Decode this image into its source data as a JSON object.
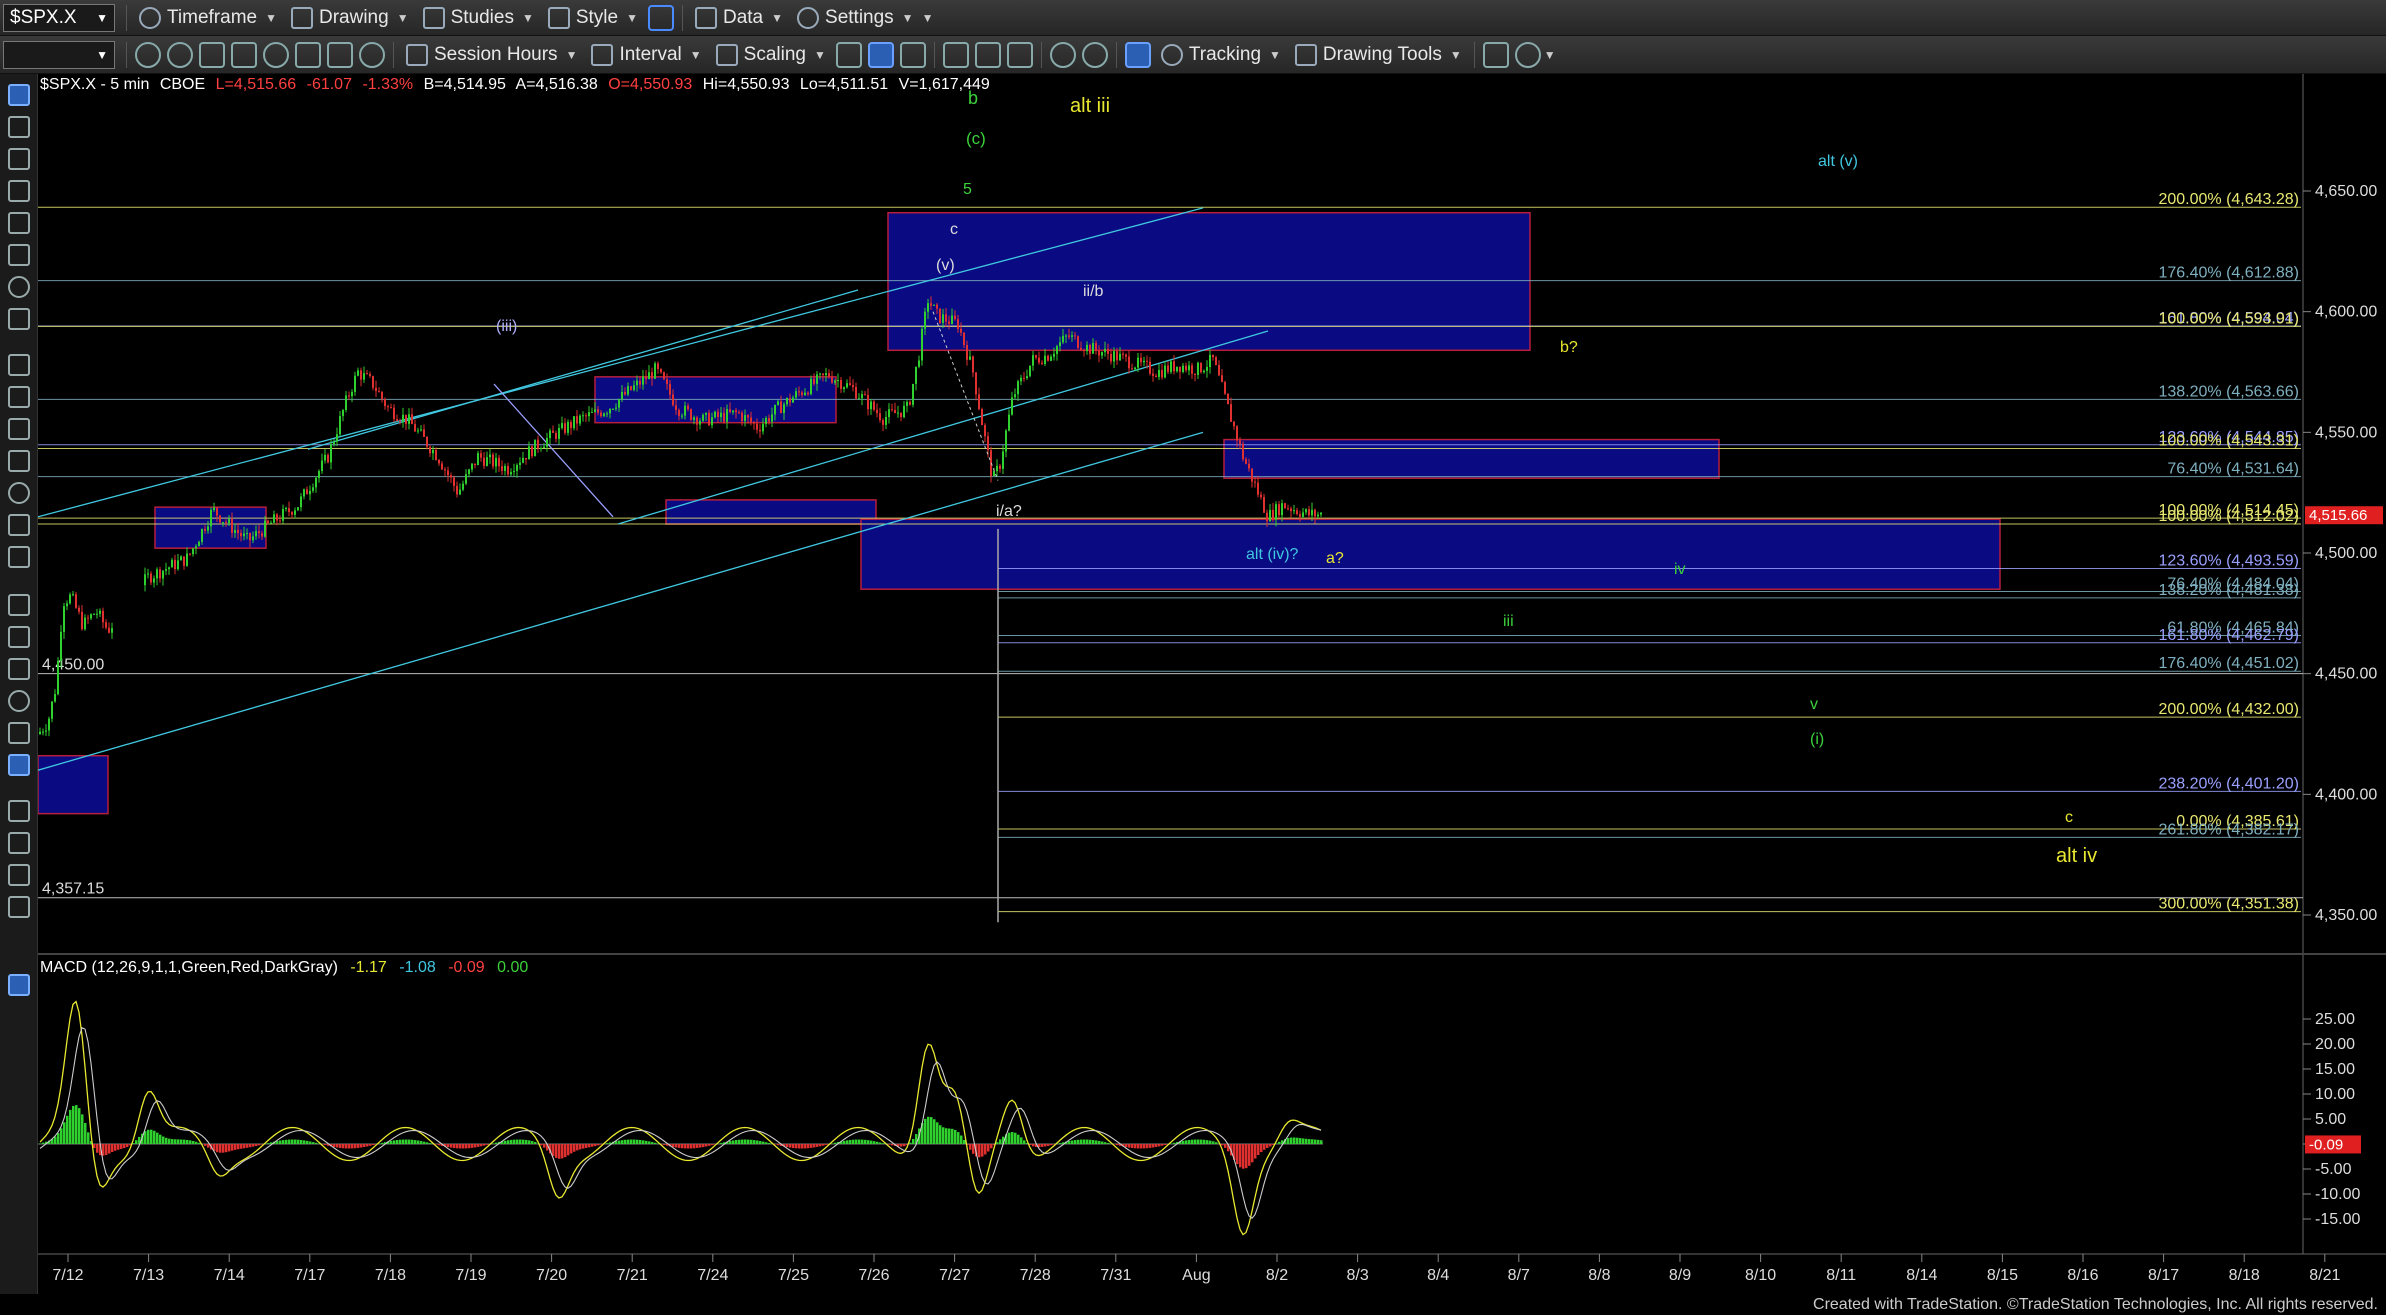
{
  "toolbar1": {
    "symbol": "$SPX.X",
    "timeframe": "Timeframe",
    "drawing": "Drawing",
    "studies": "Studies",
    "style": "Style",
    "data": "Data",
    "settings": "Settings"
  },
  "toolbar2": {
    "session_hours": "Session Hours",
    "interval": "Interval",
    "scaling": "Scaling",
    "tracking": "Tracking",
    "drawing_tools": "Drawing Tools"
  },
  "header": {
    "symbol": "$SPX.X - 5 min",
    "exchange": "CBOE",
    "last": "L=4,515.66",
    "change": "-61.07",
    "pct": "-1.33%",
    "bid": "B=4,514.95",
    "ask": "A=4,516.38",
    "open": "O=4,550.93",
    "high": "Hi=4,550.93",
    "low": "Lo=4,511.51",
    "volume": "V=1,617,449"
  },
  "macd": {
    "label": "MACD (12,26,9,1,1,Green,Red,DarkGray)",
    "v1": "-1.17",
    "v2": "-1.08",
    "v3": "-0.09",
    "v4": "0.00",
    "current": "-0.09",
    "ticks": [
      "25.00",
      "20.00",
      "15.00",
      "10.00",
      "5.00",
      "0.00",
      "-5.00",
      "-10.00",
      "-15.00"
    ]
  },
  "price_axis": {
    "ticks": [
      "4,650.00",
      "4,600.00",
      "4,550.00",
      "4,500.00",
      "4,450.00",
      "4,400.00",
      "4,350.00"
    ],
    "current": "4,515.66"
  },
  "time_axis": [
    "7/12",
    "7/13",
    "7/14",
    "7/17",
    "7/18",
    "7/19",
    "7/20",
    "7/21",
    "7/24",
    "7/25",
    "7/26",
    "7/27",
    "7/28",
    "7/31",
    "Aug",
    "8/2",
    "8/3",
    "8/4",
    "8/7",
    "8/8",
    "8/9",
    "8/10",
    "8/11",
    "8/14",
    "8/15",
    "8/16",
    "8/17",
    "8/18",
    "8/21"
  ],
  "fib_levels": [
    {
      "label": "200.00% (4,643.28)",
      "price": 4643.28,
      "color": "#e8e870"
    },
    {
      "label": "176.40% (4,612.88)",
      "price": 4612.88,
      "color": "#7fb0c0"
    },
    {
      "label": "161.80% (4,594.04)",
      "price": 4594.04,
      "color": "#9aa0ff"
    },
    {
      "label": "100.00% (4,593.91)",
      "price": 4593.91,
      "color": "#e8e870"
    },
    {
      "label": "138.20% (4,563.66)",
      "price": 4563.66,
      "color": "#7fb0c0"
    },
    {
      "label": "123.60% (4,544.85)",
      "price": 4544.85,
      "color": "#9aa0ff"
    },
    {
      "label": "100.00% (4,543.31)",
      "price": 4543.31,
      "color": "#e8e870"
    },
    {
      "label": "76.40% (4,531.64)",
      "price": 4531.64,
      "color": "#7fb0c0"
    },
    {
      "label": "100.00% (4,514.45)",
      "price": 4514.45,
      "color": "#e8e870"
    },
    {
      "label": "100.00% (4,512.02)",
      "price": 4512.02,
      "color": "#e8e870"
    },
    {
      "label": "123.60% (4,493.59)",
      "price": 4493.59,
      "color": "#9aa0ff"
    },
    {
      "label": "76.40% (4,484.04)",
      "price": 4484.04,
      "color": "#7fb0c0"
    },
    {
      "label": "138.20% (4,481.38)",
      "price": 4481.38,
      "color": "#7fb0c0"
    },
    {
      "label": "61.80% (4,465.84)",
      "price": 4465.84,
      "color": "#7fb0c0"
    },
    {
      "label": "161.80% (4,462.79)",
      "price": 4462.79,
      "color": "#9aa0ff"
    },
    {
      "label": "176.40% (4,451.02)",
      "price": 4451.02,
      "color": "#7fb0c0"
    },
    {
      "label": "200.00% (4,432.00)",
      "price": 4432.0,
      "color": "#e8e870"
    },
    {
      "label": "238.20% (4,401.20)",
      "price": 4401.2,
      "color": "#9aa0ff"
    },
    {
      "label": "0.00% (4,385.61)",
      "price": 4385.61,
      "color": "#e8e870"
    },
    {
      "label": "261.80% (4,382.17)",
      "price": 4382.17,
      "color": "#7fb0c0"
    },
    {
      "label": "300.00% (4,351.38)",
      "price": 4351.38,
      "color": "#e8e870"
    }
  ],
  "price_labels": [
    {
      "text": "4,450.00",
      "price": 4450
    },
    {
      "text": "4,357.15",
      "price": 4357.15
    }
  ],
  "wave_labels": [
    {
      "text": "b",
      "color": "#3bd13b"
    },
    {
      "text": "(c)",
      "color": "#3bd13b"
    },
    {
      "text": "5",
      "color": "#3bd13b"
    },
    {
      "text": "alt iii",
      "color": "#e8e830"
    },
    {
      "text": "alt (v)",
      "color": "#40c8e0"
    },
    {
      "text": "c",
      "color": "#dddddd"
    },
    {
      "text": "(v)",
      "color": "#dddddd"
    },
    {
      "text": "ii/b",
      "color": "#dddddd"
    },
    {
      "text": "(iii)",
      "color": "#b0b0ff"
    },
    {
      "text": "b?",
      "color": "#e8e830"
    },
    {
      "text": "i/a?",
      "color": "#dddddd"
    },
    {
      "text": "alt (iv)?",
      "color": "#40c8e0"
    },
    {
      "text": "a?",
      "color": "#e8e830"
    },
    {
      "text": "iv",
      "color": "#3bd13b"
    },
    {
      "text": "iii",
      "color": "#3bd13b"
    },
    {
      "text": "v",
      "color": "#3bd13b"
    },
    {
      "text": "(i)",
      "color": "#3bd13b"
    },
    {
      "text": "c",
      "color": "#e8e830"
    },
    {
      "text": "alt iv",
      "color": "#e8e830"
    }
  ],
  "footer": "Created with TradeStation. ©TradeStation Technologies, Inc. All rights reserved.",
  "colors": {
    "up": "#2fd12f",
    "down": "#e03030",
    "zone": "#0b0b8a",
    "zone_border": "#c02040"
  }
}
